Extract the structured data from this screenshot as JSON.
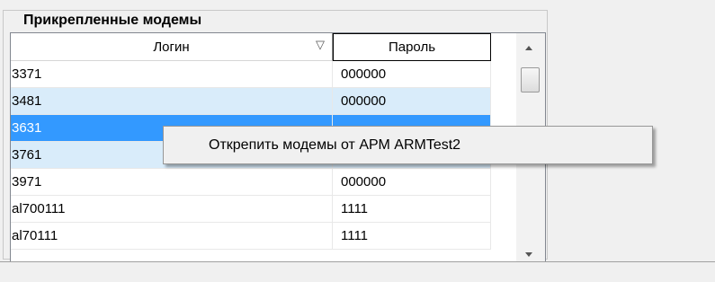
{
  "groupbox": {
    "title": "Прикрепленные модемы"
  },
  "grid": {
    "columns": [
      "Логин",
      "Пароль"
    ],
    "sort_icon": "filter-triangle-icon",
    "rows": [
      {
        "login": "3371",
        "password": "000000",
        "state": "normal"
      },
      {
        "login": "3481",
        "password": "000000",
        "state": "highlighted"
      },
      {
        "login": "3631",
        "password": "",
        "state": "selected"
      },
      {
        "login": "3761",
        "password": "",
        "state": "highlighted"
      },
      {
        "login": "3971",
        "password": "000000",
        "state": "normal"
      },
      {
        "login": "al700111",
        "password": "1111",
        "state": "normal"
      },
      {
        "login": "al70111",
        "password": "1111",
        "state": "normal"
      }
    ]
  },
  "context_menu": {
    "items": [
      "Открепить модемы от АРМ ARMTest2"
    ]
  },
  "colors": {
    "selected_row": "#3399ff",
    "highlighted_row": "#d9ecfa",
    "window_bg": "#f0f0f0"
  }
}
